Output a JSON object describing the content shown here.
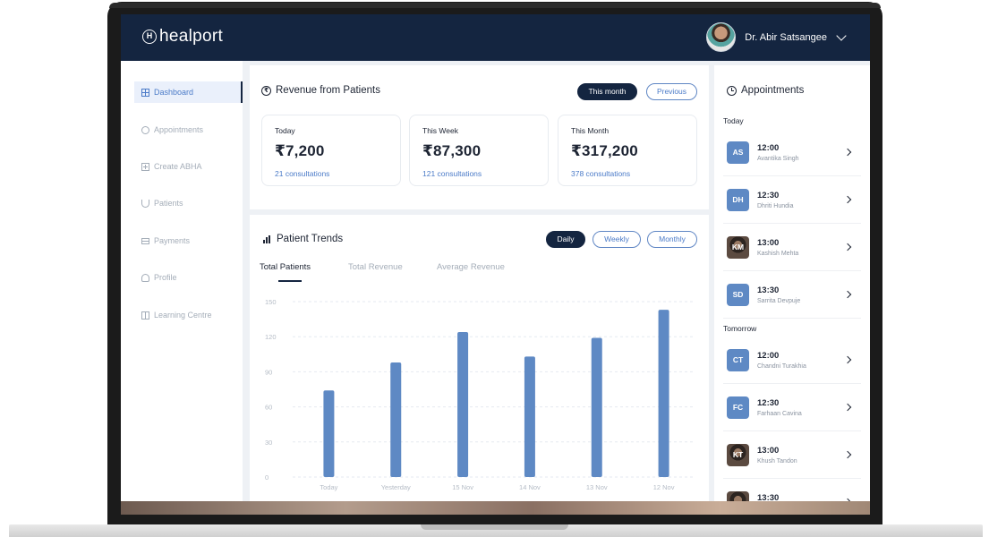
{
  "brand": {
    "logo_letter": "H",
    "name": "healport"
  },
  "user": {
    "name": "Dr. Abir Satsangee"
  },
  "sidebar": {
    "items": [
      {
        "label": "Dashboard",
        "icon": "grid-icon"
      },
      {
        "label": "Appointments",
        "icon": "clock-icon"
      },
      {
        "label": "Create ABHA",
        "icon": "plus-square-icon"
      },
      {
        "label": "Patients",
        "icon": "stethoscope-icon"
      },
      {
        "label": "Payments",
        "icon": "credit-card-icon"
      },
      {
        "label": "Profile",
        "icon": "user-icon"
      },
      {
        "label": "Learning Centre",
        "icon": "book-icon"
      }
    ],
    "active": "Dashboard"
  },
  "revenue": {
    "title": "Revenue from Patients",
    "toggle": {
      "current": "This month",
      "previous": "Previous"
    },
    "cards": [
      {
        "label": "Today",
        "value": "₹7,200",
        "sub": "21 consultations"
      },
      {
        "label": "This Week",
        "value": "₹87,300",
        "sub": "121 consultations"
      },
      {
        "label": "This Month",
        "value": "₹317,200",
        "sub": "378 consultations"
      }
    ]
  },
  "trends": {
    "title": "Patient Trends",
    "periods": [
      "Daily",
      "Weekly",
      "Monthly"
    ],
    "active_period": "Daily",
    "tabs": [
      "Total Patients",
      "Total Revenue",
      "Average Revenue"
    ],
    "active_tab": "Total Patients"
  },
  "chart_data": {
    "type": "bar",
    "categories": [
      "Today",
      "Yesterday",
      "15 Nov",
      "14 Nov",
      "13 Nov",
      "12 Nov"
    ],
    "values": [
      74,
      98,
      124,
      103,
      119,
      143
    ],
    "ylim": [
      0,
      150
    ],
    "yticks": [
      0,
      30,
      60,
      90,
      120,
      150
    ],
    "grid": true,
    "bar_color": "#5e89c4"
  },
  "appointments": {
    "title": "Appointments",
    "sections": [
      {
        "label": "Today",
        "items": [
          {
            "initials": "AS",
            "time": "12:00",
            "name": "Avantika Singh",
            "photo": false
          },
          {
            "initials": "DH",
            "time": "12:30",
            "name": "Dhriti Hundia",
            "photo": false
          },
          {
            "initials": "KM",
            "time": "13:00",
            "name": "Kashish Mehta",
            "photo": true
          },
          {
            "initials": "SD",
            "time": "13:30",
            "name": "Sarrita Devpuje",
            "photo": false
          }
        ]
      },
      {
        "label": "Tomorrow",
        "items": [
          {
            "initials": "CT",
            "time": "12:00",
            "name": "Chandni Turakhia",
            "photo": false
          },
          {
            "initials": "FC",
            "time": "12:30",
            "name": "Farhaan Cavina",
            "photo": false
          },
          {
            "initials": "KT",
            "time": "13:00",
            "name": "Khush Tandon",
            "photo": true
          },
          {
            "initials": "",
            "time": "13:30",
            "name": "",
            "photo": true
          }
        ]
      }
    ]
  },
  "colors": {
    "navy": "#142540",
    "accent": "#4b7bc8",
    "bar": "#5e89c4"
  }
}
